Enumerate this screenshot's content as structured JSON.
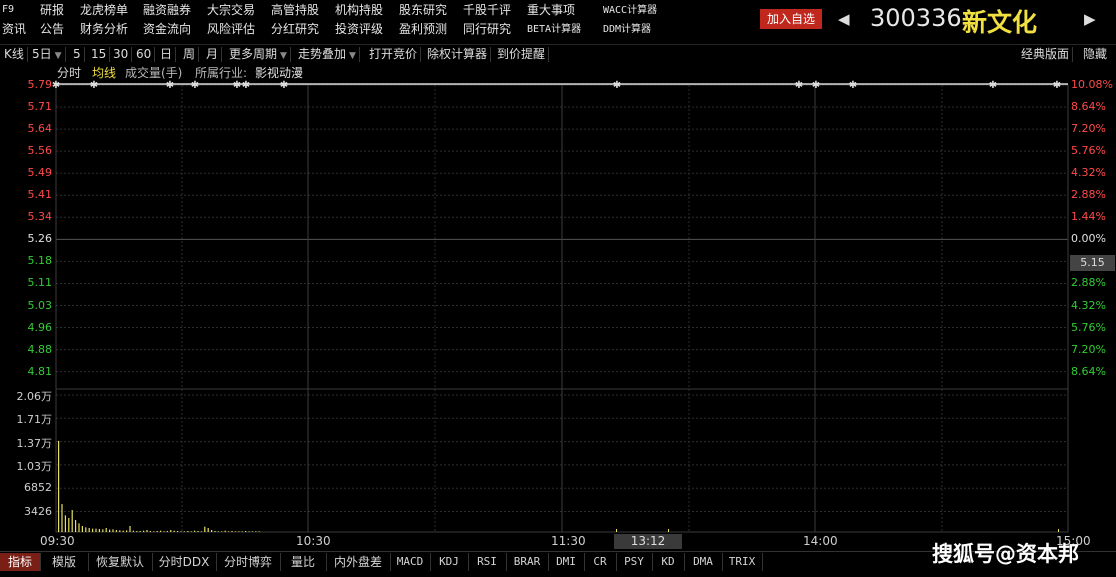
{
  "topmenu": {
    "row1": [
      "F9",
      "研报",
      "龙虎榜单",
      "融资融券",
      "大宗交易",
      "高管持股",
      "机构持股",
      "股东研究",
      "千股千评",
      "重大事项",
      "WACC计算器"
    ],
    "row2": [
      "资讯",
      "公告",
      "财务分析",
      "资金流向",
      "风险评估",
      "分红研究",
      "投资评级",
      "盈利预测",
      "同行研究",
      "BETA计算器",
      "DDM计算器"
    ]
  },
  "header": {
    "add_favorite": "加入自选",
    "stock_code": "300336",
    "stock_name": "新文化"
  },
  "toolbar": {
    "kline": "K线",
    "period": "5日",
    "opts": [
      "5",
      "15",
      "30",
      "60",
      "日",
      "周",
      "月"
    ],
    "more_periods": "更多周期",
    "overlay": "走势叠加",
    "bid": "打开竞价",
    "exright": "除权计算器",
    "alert": "到价提醒",
    "classic": "经典版面",
    "hide": "隐藏"
  },
  "indicator_line": {
    "fenshi": "分时",
    "avg_line": "均线",
    "volume": "成交量(手)",
    "industry_label": "所属行业:",
    "industry": "影视动漫"
  },
  "chart_data": {
    "type": "line",
    "price_axis": [
      "5.79",
      "5.71",
      "5.64",
      "5.56",
      "5.49",
      "5.41",
      "5.34",
      "5.26",
      "5.18",
      "5.11",
      "5.03",
      "4.96",
      "4.88",
      "4.81"
    ],
    "pct_axis": [
      "10.08%",
      "8.64%",
      "7.20%",
      "5.76%",
      "4.32%",
      "2.88%",
      "1.44%",
      "0.00%",
      "2.88%",
      "4.32%",
      "5.76%",
      "7.20%",
      "8.64%"
    ],
    "volume_axis": [
      "2.06万",
      "1.71万",
      "1.37万",
      "1.03万",
      "6852",
      "3426"
    ],
    "x_labels": [
      "09:30",
      "10:30",
      "11:30",
      "14:00",
      "15:00"
    ],
    "cursor_time": "13:12",
    "cursor_price": "5.15",
    "price": 5.79,
    "colors": {
      "up": "#ff4a4a",
      "down": "#33cc33",
      "flat": "#e0e0e0",
      "grid": "#2e2e2e",
      "volume": "#e8e060"
    },
    "volume_bars": [
      13700,
      4200,
      2500,
      2100,
      3300,
      1800,
      1300,
      900,
      700,
      600,
      500,
      500,
      450,
      400,
      600,
      350,
      400,
      300,
      250,
      200,
      250,
      900,
      200,
      150,
      150,
      200,
      300,
      150,
      100,
      150,
      200,
      100,
      150,
      300,
      200,
      150,
      100,
      100,
      150,
      100,
      200,
      150,
      100,
      800,
      600,
      300,
      150,
      100,
      100,
      200,
      100,
      150,
      100,
      100,
      100,
      150,
      100,
      100,
      100,
      100
    ]
  },
  "bottom_tabs": [
    "指标",
    "模版",
    "恢复默认",
    "分时DDX",
    "分时博弈",
    "量比",
    "内外盘差",
    "MACD",
    "KDJ",
    "RSI",
    "BRAR",
    "DMI",
    "CR",
    "PSY",
    "KD",
    "DMA",
    "TRIX"
  ],
  "watermark": "搜狐号@资本邦"
}
